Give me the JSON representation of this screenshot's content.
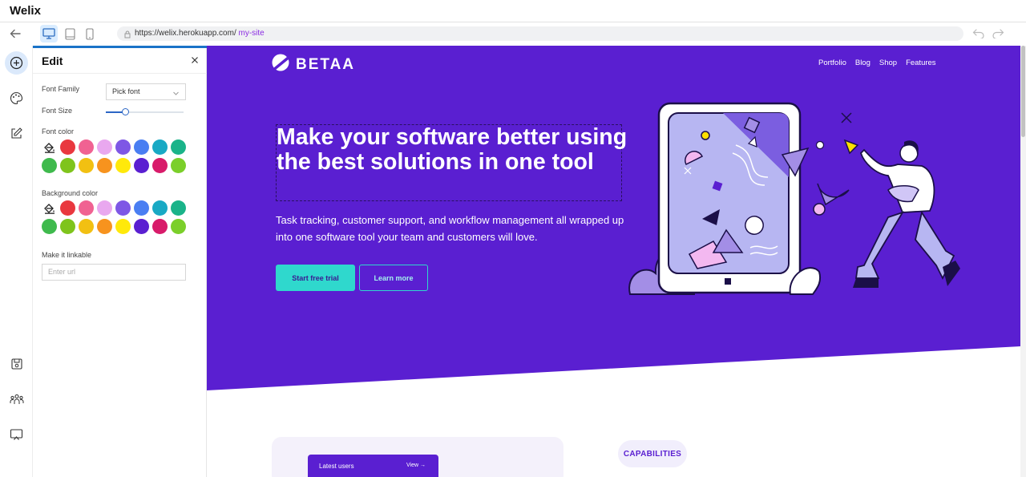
{
  "app": {
    "title": "Welix"
  },
  "toolbar": {
    "url_base": "https://welix.herokuapp.com/",
    "url_slug": " my-site",
    "devices": [
      "desktop-icon",
      "tablet-icon",
      "phone-icon"
    ],
    "active_device": "desktop"
  },
  "rail": {
    "items": [
      "add-icon",
      "palette-icon",
      "edit-icon",
      "save-icon",
      "users-icon",
      "preview-icon"
    ]
  },
  "panel": {
    "title": "Edit",
    "font_family_label": "Font Family",
    "font_family_value": "Pick font",
    "font_size_label": "Font Size",
    "font_size_level": 0.25,
    "font_color_label": "Font color",
    "background_color_label": "Background color",
    "linkable_label": "Make it linkable",
    "url_placeholder": "Enter url",
    "palette_row1": [
      "#e9383f",
      "#f06292",
      "#e9a8ef",
      "#7e57e5",
      "#4a7ef2",
      "#19a9c4",
      "#1ab389"
    ],
    "palette_row2": [
      "#3fba4d",
      "#7fc41c",
      "#f2c012",
      "#f7931e",
      "#ffe90b",
      "#5a1fd1",
      "#d81b6a",
      "#7bcf2a"
    ]
  },
  "site": {
    "brand": "BETAA",
    "nav": [
      "Portfolio",
      "Blog",
      "Shop",
      "Features"
    ],
    "hero_title": "Make your software better using the best solutions in one tool",
    "hero_subtitle": "Task tracking, customer support, and workflow management all wrapped up into one software tool your team and customers will love.",
    "primary_cta": "Start free trial",
    "secondary_cta": "Learn more",
    "latest_users": "Latest users",
    "view_label": "View",
    "capabilities": "CAPABILITIES",
    "colors": {
      "hero_bg": "#5a1fd1",
      "accent": "#2fd8cd"
    }
  }
}
